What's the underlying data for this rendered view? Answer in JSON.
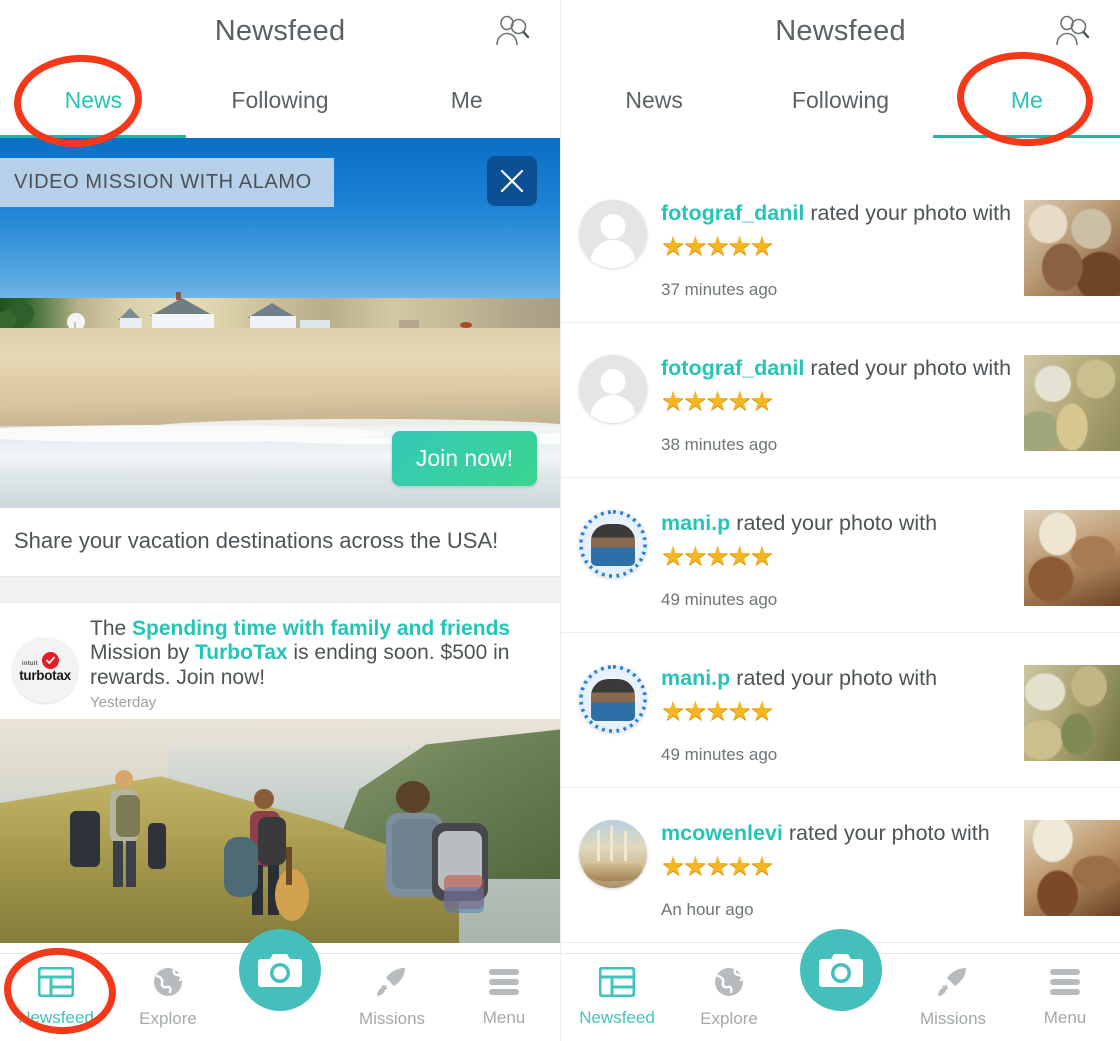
{
  "panels": [
    {
      "id": "left",
      "header": {
        "title": "Newsfeed",
        "find_friends_icon": "person-search-icon"
      },
      "tabs": [
        {
          "label": "News",
          "active": true
        },
        {
          "label": "Following",
          "active": false
        },
        {
          "label": "Me",
          "active": false
        }
      ],
      "annotation": {
        "target": "News tab",
        "color": "#f4381a"
      },
      "mission_card": {
        "label": "VIDEO MISSION WITH ALAMO",
        "close_icon": "close-icon",
        "join_label": "Join now!",
        "caption": "Share your vacation destinations across the USA!"
      },
      "promo": {
        "logo": "turbotax-logo",
        "logo_intuit": "intuit",
        "logo_word": "turbotax",
        "prefix": "The ",
        "mission_name": "Spending time with family and friends",
        "middle": " Mission by ",
        "brand": "TurboTax",
        "suffix": " is ending soon. $500 in rewards. Join now!",
        "time": "Yesterday"
      },
      "bottom_nav": [
        {
          "label": "Newsfeed",
          "icon": "newsfeed-grid-icon",
          "active": true
        },
        {
          "label": "Explore",
          "icon": "globe-icon",
          "active": false
        },
        {
          "label": "Missions",
          "icon": "rocket-icon",
          "active": false
        },
        {
          "label": "Menu",
          "icon": "hamburger-menu-icon",
          "active": false
        }
      ],
      "fab": {
        "icon": "camera-icon",
        "color": "#45bfbc"
      },
      "nav_annotation": {
        "target": "Newsfeed nav item",
        "color": "#f4381a"
      }
    },
    {
      "id": "right",
      "header": {
        "title": "Newsfeed",
        "find_friends_icon": "person-search-icon"
      },
      "tabs": [
        {
          "label": "News",
          "active": false
        },
        {
          "label": "Following",
          "active": false
        },
        {
          "label": "Me",
          "active": true
        }
      ],
      "annotation": {
        "target": "Me tab",
        "color": "#f4381a"
      },
      "notifications": [
        {
          "user": "fotograf_danil",
          "action": "rated your photo with",
          "stars": 5,
          "time": "37 minutes ago",
          "avatar": "default-avatar",
          "thumb": "leaf-a"
        },
        {
          "user": "fotograf_danil",
          "action": "rated your photo with",
          "stars": 5,
          "time": "38 minutes ago",
          "avatar": "default-avatar",
          "thumb": "leaf-b"
        },
        {
          "user": "mani.p",
          "action": "rated your photo with",
          "stars": 5,
          "time": "49 minutes ago",
          "avatar": "mani-avatar",
          "thumb": "leaf-c"
        },
        {
          "user": "mani.p",
          "action": "rated your photo with",
          "stars": 5,
          "time": "49 minutes ago",
          "avatar": "mani-avatar",
          "thumb": "leaf-d"
        },
        {
          "user": "mcowenlevi",
          "action": "rated your photo with",
          "stars": 5,
          "time": "An hour ago",
          "avatar": "ship-avatar",
          "thumb": "leaf-e"
        }
      ],
      "bottom_nav": [
        {
          "label": "Newsfeed",
          "icon": "newsfeed-grid-icon",
          "active": true
        },
        {
          "label": "Explore",
          "icon": "globe-icon",
          "active": false
        },
        {
          "label": "Missions",
          "icon": "rocket-icon",
          "active": false
        },
        {
          "label": "Menu",
          "icon": "hamburger-menu-icon",
          "active": false
        }
      ],
      "fab": {
        "icon": "camera-icon",
        "color": "#45bfbc"
      }
    }
  ],
  "colors": {
    "accent_teal": "#25c4b6",
    "nav_teal": "#3fc4bd",
    "fab_teal": "#45bfbc",
    "annotation_red": "#f4381a",
    "star_gold": "#f5b622",
    "text_grey": "#4d5457"
  },
  "star_glyph": "★"
}
